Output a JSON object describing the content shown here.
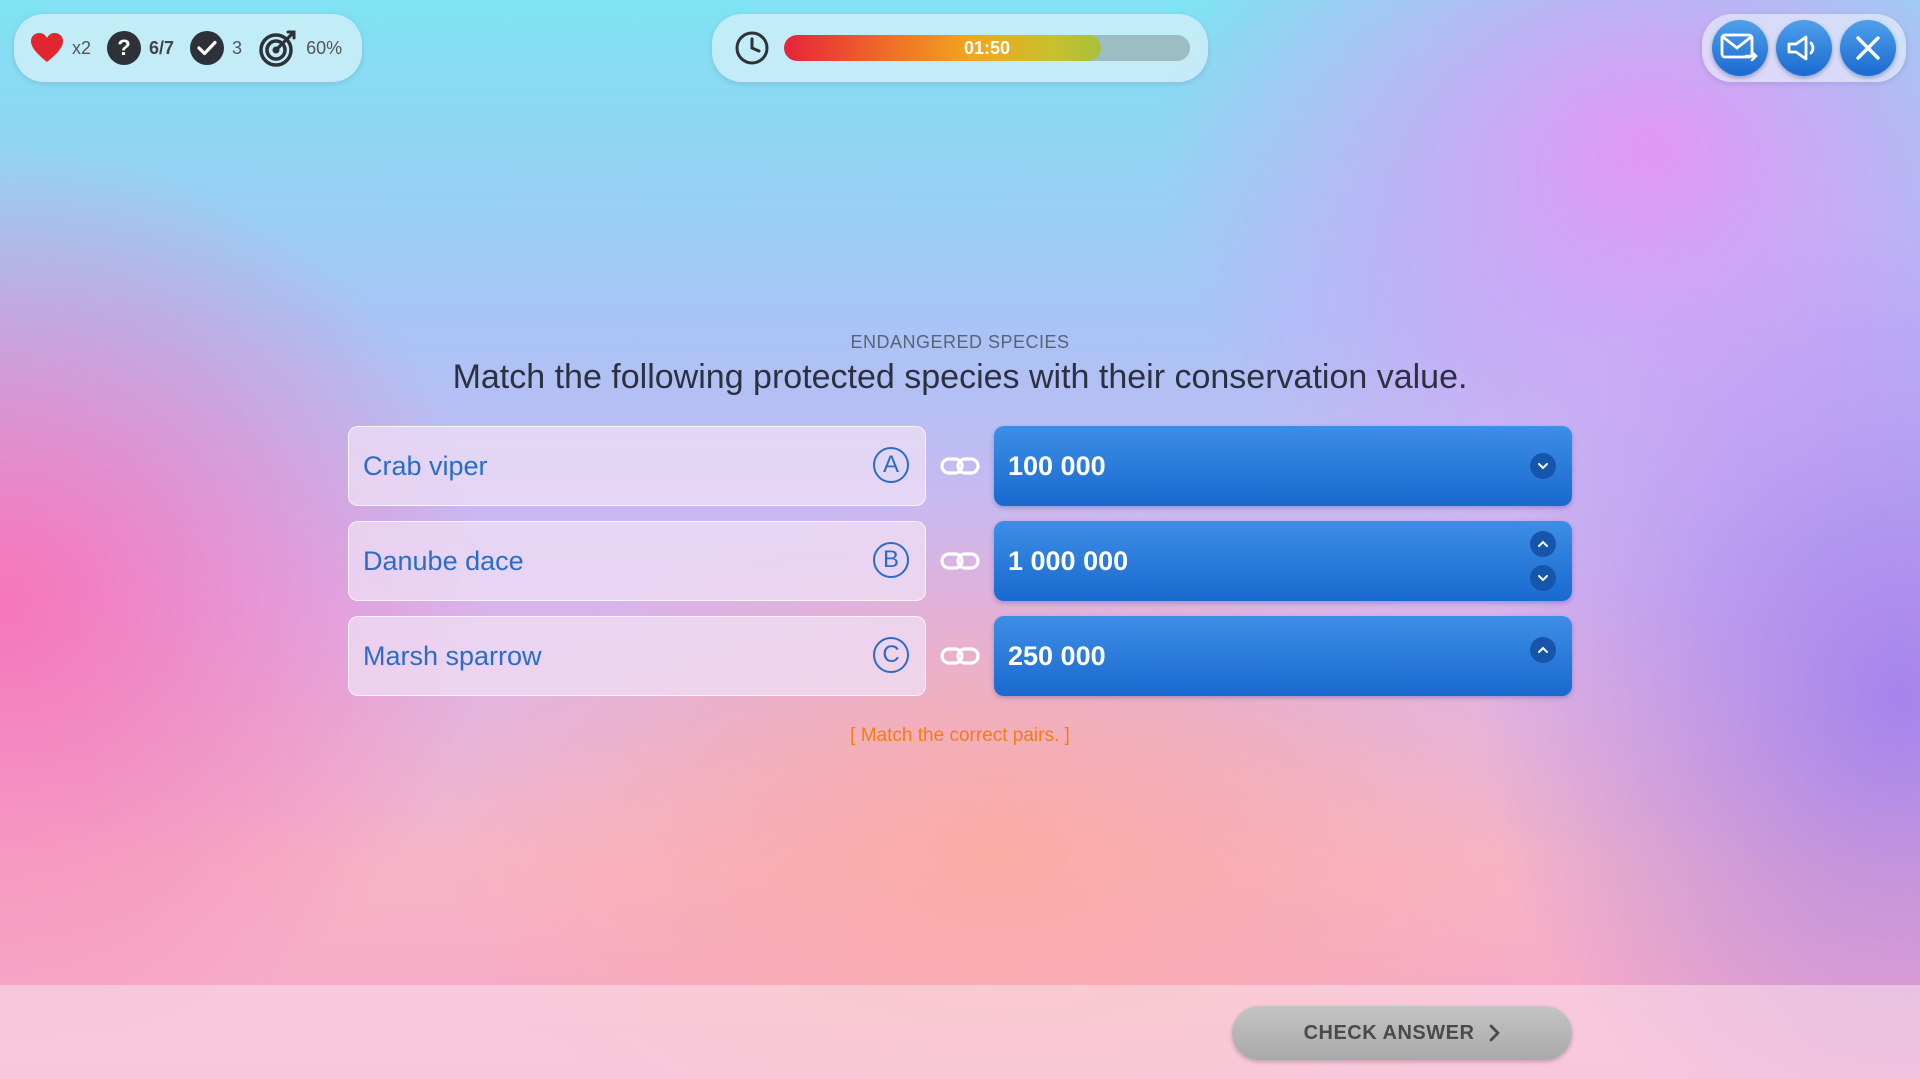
{
  "stats": {
    "lives": "x2",
    "question_progress": "6/7",
    "correct_count": "3",
    "accuracy": "60%"
  },
  "timer": {
    "time": "01:50",
    "progress": 0.78
  },
  "quiz": {
    "category": "ENDANGERED SPECIES",
    "question": "Match the following protected species with their conservation value.",
    "pairs": [
      {
        "left": "Crab viper",
        "letter": "A",
        "right": "100 000"
      },
      {
        "left": "Danube dace",
        "letter": "B",
        "right": "1 000 000"
      },
      {
        "left": "Marsh sparrow",
        "letter": "C",
        "right": "250 000"
      }
    ],
    "hint": "[ Match the correct pairs. ]"
  },
  "footer": {
    "check_label": "CHECK ANSWER"
  },
  "colors": {
    "accent": "#1a69cf",
    "hint": "#f07f12",
    "heart": "#e0262f"
  }
}
